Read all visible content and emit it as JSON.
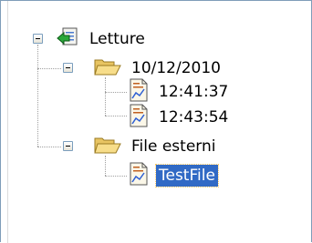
{
  "tree": {
    "root": {
      "label": "Letture",
      "icon": "network-drive-arrow-icon"
    },
    "folders": [
      {
        "label": "10/12/2010",
        "icon": "open-folder-icon",
        "files": [
          {
            "label": "12:41:37",
            "icon": "chart-document-icon"
          },
          {
            "label": "12:43:54",
            "icon": "chart-document-icon"
          }
        ]
      },
      {
        "label": "File esterni",
        "icon": "open-folder-icon",
        "files": [
          {
            "label": "TestFile",
            "icon": "chart-document-icon",
            "selected": true
          }
        ]
      }
    ]
  },
  "colors": {
    "selection": "#316ac5",
    "connector": "#a0a0a0"
  }
}
